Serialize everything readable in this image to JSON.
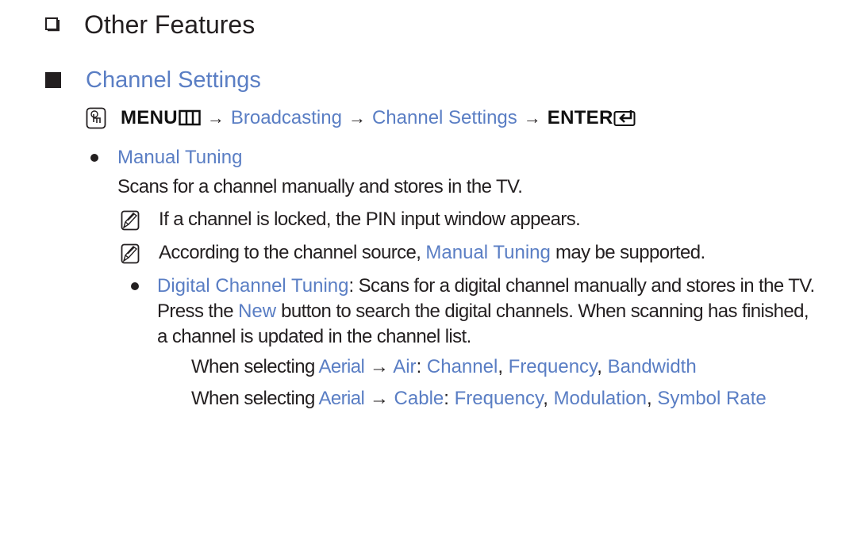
{
  "heading": {
    "title": "Other Features",
    "icon": "hollow-square-icon"
  },
  "section": {
    "title": "Channel Settings",
    "icon": "filled-square-icon"
  },
  "menu_path": {
    "remote_icon": "remote-hand-icon",
    "menu_label": "MENU",
    "menu_icon": "menu-grid-icon",
    "arrow": "→",
    "steps": [
      "Broadcasting",
      "Channel Settings"
    ],
    "enter_label": "ENTER",
    "enter_icon": "enter-return-icon"
  },
  "item": {
    "title": "Manual Tuning",
    "description": "Scans for a channel manually and stores in the TV.",
    "notes": [
      {
        "icon": "note-pencil-icon",
        "text": "If a channel is locked, the PIN input window appears."
      },
      {
        "icon": "note-pencil-icon",
        "before": "According to the channel source, ",
        "link": "Manual Tuning",
        "after": " may be supported."
      }
    ],
    "sub_item": {
      "title": "Digital Channel Tuning",
      "text_1": ": Scans for a digital channel manually and stores in the TV. Press the ",
      "button_name": "New",
      "text_2": " button to search the digital channels. When scanning has finished, a channel is updated in the channel list."
    },
    "conditions": [
      {
        "prefix": "When selecting ",
        "source": "Aerial",
        "arrow": " → ",
        "type": "Air",
        "colon": ": ",
        "options": [
          "Channel",
          "Frequency",
          "Bandwidth"
        ],
        "separator": ", "
      },
      {
        "prefix": "When selecting ",
        "source": "Aerial",
        "arrow": " → ",
        "type": "Cable",
        "colon": ": ",
        "options": [
          "Frequency",
          "Modulation",
          "Symbol Rate"
        ],
        "separator": ", "
      }
    ]
  },
  "colors": {
    "accent_blue": "#5a7ec4",
    "text": "#231f20"
  }
}
